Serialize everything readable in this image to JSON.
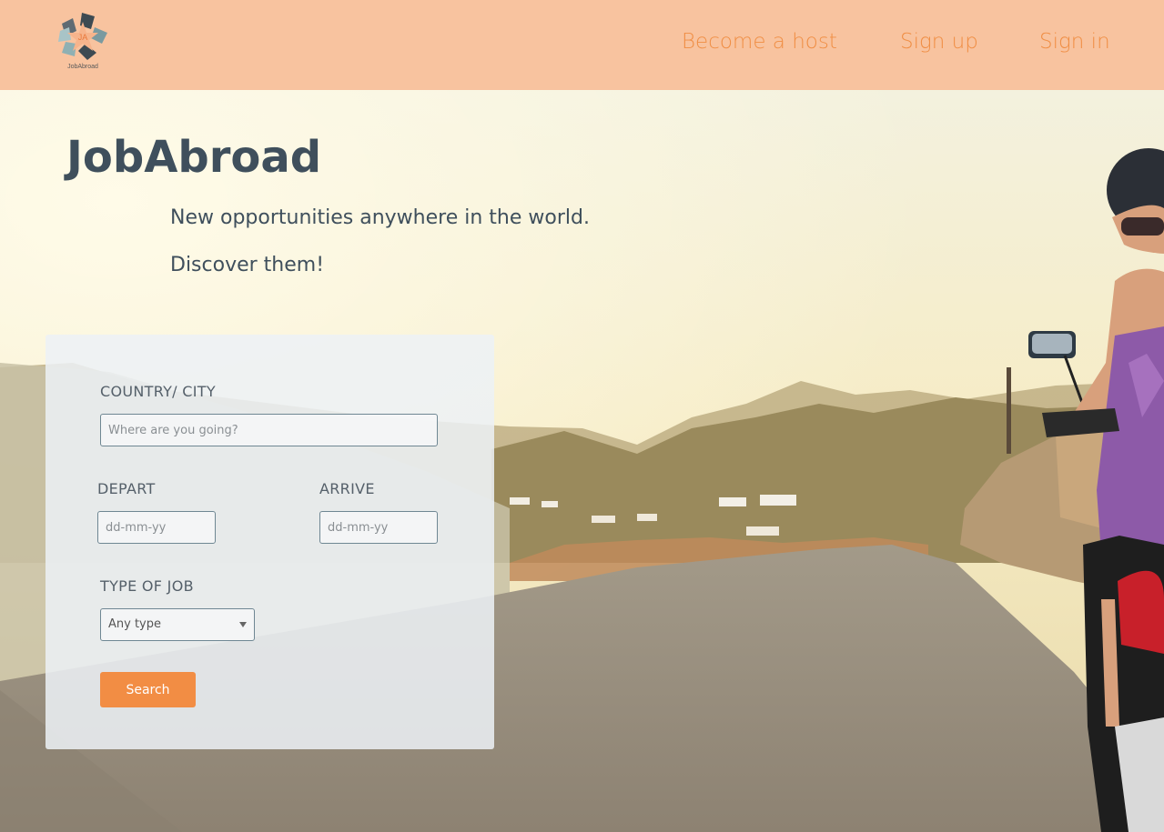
{
  "brand": {
    "logo_text": "JobAbroad",
    "logo_initials": "JA"
  },
  "nav": {
    "become_host": "Become a host",
    "sign_up": "Sign up",
    "sign_in": "Sign in"
  },
  "hero": {
    "title": "JobAbroad",
    "tagline_1": "New opportunities anywhere in the world.",
    "tagline_2": "Discover them!"
  },
  "search_form": {
    "country_label": "COUNTRY/ CITY",
    "country_placeholder": "Where are you going?",
    "depart_label": "DEPART",
    "depart_placeholder": "dd-mm-yy",
    "arrive_label": "ARRIVE",
    "arrive_placeholder": "dd-mm-yy",
    "job_type_label": "TYPE OF JOB",
    "job_type_selected": "Any type",
    "search_button": "Search"
  },
  "colors": {
    "header_bg": "#f8c39f",
    "accent": "#f28d44",
    "title_text": "#3f4f5c"
  },
  "icons": [
    "logo-icon",
    "chevron-down-icon"
  ]
}
